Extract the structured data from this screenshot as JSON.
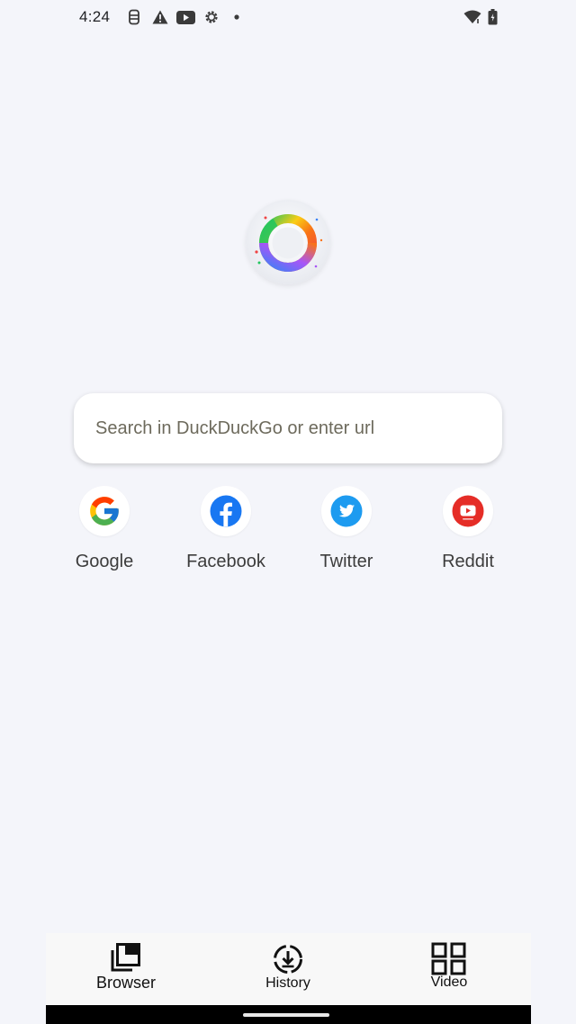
{
  "status_bar": {
    "time": "4:24",
    "left_icons": [
      "sim-card-icon",
      "warning-icon",
      "youtube-icon",
      "settings-icon",
      "notification-dot-icon"
    ],
    "right_icons": [
      "wifi-icon",
      "battery-icon"
    ]
  },
  "logo": {
    "icon": "app-logo-ring-icon"
  },
  "search": {
    "placeholder": "Search in DuckDuckGo or enter url",
    "value": ""
  },
  "shortcuts": [
    {
      "label": "Google",
      "icon": "google-icon",
      "color": "#4285f4"
    },
    {
      "label": "Facebook",
      "icon": "facebook-icon",
      "color": "#1877f2"
    },
    {
      "label": "Twitter",
      "icon": "twitter-icon",
      "color": "#1d9bf0"
    },
    {
      "label": "Reddit",
      "icon": "youtube-red-icon",
      "color": "#e52d27"
    }
  ],
  "bottom_nav": [
    {
      "label": "Browser",
      "icon": "browser-tabs-icon"
    },
    {
      "label": "History",
      "icon": "history-download-icon"
    },
    {
      "label": "Video",
      "icon": "grid-icon"
    }
  ]
}
